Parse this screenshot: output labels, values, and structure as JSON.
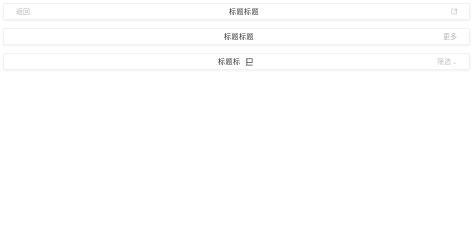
{
  "rows": [
    {
      "left_label": "返回",
      "title": "标题标题",
      "right_icon": "edit-icon"
    },
    {
      "title": "标题标题",
      "right_label": "更多"
    },
    {
      "title": "标题标",
      "title_icon": "flag-icon",
      "dropdown_label": "筛选"
    }
  ],
  "colors": {
    "title": "#333333",
    "muted": "#b5b5b5",
    "border": "#f0f0f0"
  }
}
